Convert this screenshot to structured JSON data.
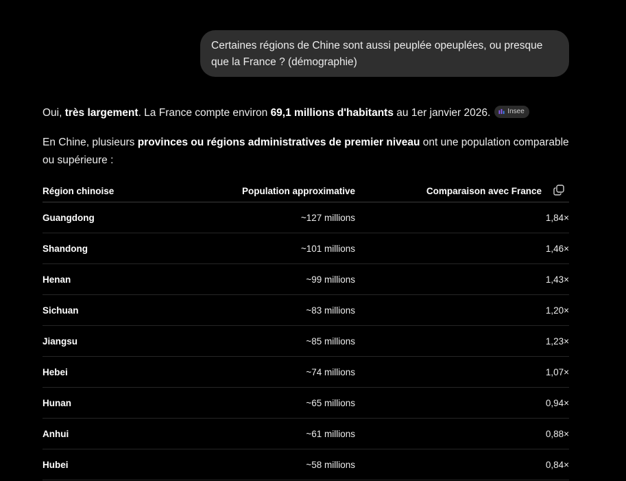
{
  "conversation": {
    "user_message": "Certaines régions de Chine sont aussi peuplée opeuplées, ou presque que la France ? (démographie)",
    "answer": {
      "p1": {
        "prefix": "Oui, ",
        "bold1": "très largement",
        "mid": ". La France compte environ ",
        "bold2": "69,1 millions d'habitants",
        "suffix": " au 1er janvier 2026.",
        "source_label": "Insee"
      },
      "p2": {
        "prefix": "En Chine, plusieurs ",
        "bold": "provinces ou régions administratives de premier niveau",
        "suffix": " ont une population comparable ou supérieure :"
      }
    },
    "table": {
      "headers": [
        "Région chinoise",
        "Population approximative",
        "Comparaison avec France"
      ],
      "rows": [
        [
          "Guangdong",
          "~127 millions",
          "1,84×"
        ],
        [
          "Shandong",
          "~101 millions",
          "1,46×"
        ],
        [
          "Henan",
          "~99 millions",
          "1,43×"
        ],
        [
          "Sichuan",
          "~83 millions",
          "1,20×"
        ],
        [
          "Jiangsu",
          "~85 millions",
          "1,23×"
        ],
        [
          "Hebei",
          "~74 millions",
          "1,07×"
        ],
        [
          "Hunan",
          "~65 millions",
          "0,94×"
        ],
        [
          "Anhui",
          "~61 millions",
          "0,88×"
        ],
        [
          "Hubei",
          "~58 millions",
          "0,84×"
        ]
      ]
    }
  },
  "icons": {
    "source": "insee-source-icon",
    "copy": "copy-table-icon"
  },
  "colors": {
    "background": "#000000",
    "bubble": "#2f2f2f",
    "text": "#ececec",
    "source_icon": "#8b5cf6"
  }
}
